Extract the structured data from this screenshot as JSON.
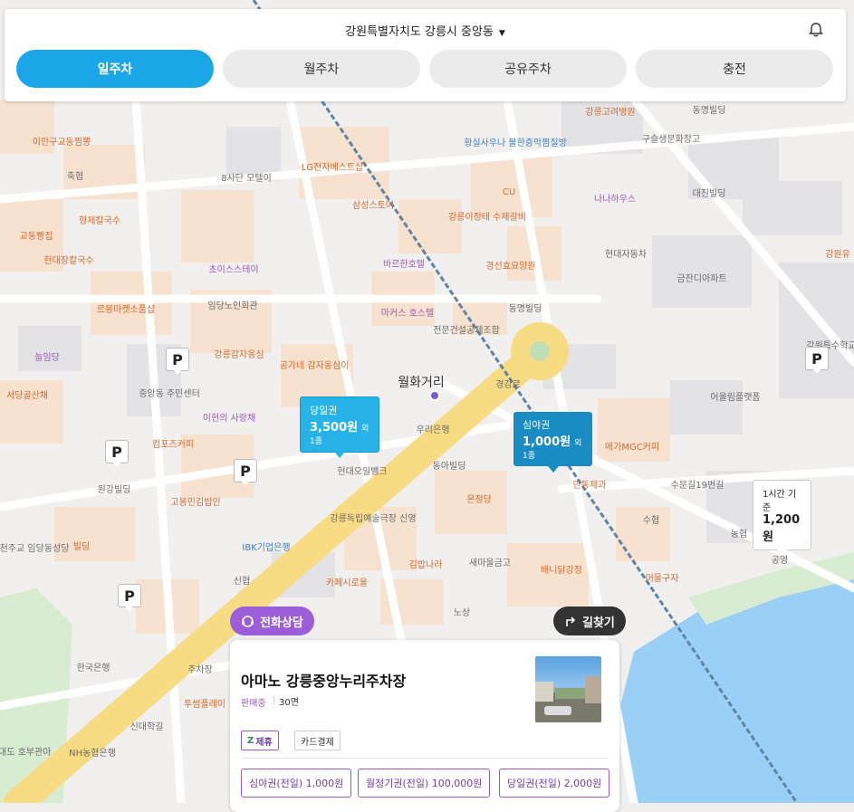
{
  "header": {
    "location": "강원특별자치도 강릉시 중앙동",
    "location_arrow": "▼"
  },
  "tabs": [
    {
      "label": "일주차",
      "active": true
    },
    {
      "label": "월주차",
      "active": false
    },
    {
      "label": "공유주차",
      "active": false
    },
    {
      "label": "충전",
      "active": false
    }
  ],
  "map": {
    "labels": [
      "강릉고려병원",
      "동명빌딩",
      "구슬생문화창고",
      "이만구교동찜뽕",
      "축협",
      "8사단 모텔이",
      "LG전자베스트샵",
      "황실사우나 불한증막찜질방",
      "CU",
      "나나하우스",
      "대진빌딩",
      "삼성스토어",
      "강릉이정태 수제갈비",
      "형제칼국수",
      "교동빵집",
      "현대장칼국수",
      "초이스스테이",
      "바르한호텔",
      "경선효요양원",
      "현대자동차",
      "금잔디아파트",
      "강원유",
      "임당노인회관",
      "르봉마켓소품샵",
      "마커스 호스텔",
      "동명빌딩",
      "전문건설공제조합",
      "늘임당",
      "강릉감자옹심",
      "공가네 감자옹심이",
      "서당골산채",
      "중앙동 주민센터",
      "이현의 사랑채",
      "월화거리",
      "우리은행",
      "어울림플랫폼",
      "강원특수학교",
      "컴포즈커피",
      "메가MGC커피",
      "동아빌딩",
      "현대오일뱅크",
      "원강빌딩",
      "고봉민김밥인",
      "온정당",
      "만동제과",
      "수문길19번길",
      "강릉독립예술극장 신영",
      "IBK기업은행",
      "천주교 임당동성당",
      "빌딩",
      "새마을금고",
      "김밥나라",
      "배니닭강정",
      "신협",
      "카페시로울",
      "머물구자",
      "농협",
      "공영",
      "노상",
      "한국은행",
      "주차장",
      "투썸플레이",
      "강릉대도 호부관아",
      "NH농협은행",
      "신대학길",
      "경강로",
      "수협"
    ]
  },
  "callouts": [
    {
      "title": "당일권",
      "price": "3,500원",
      "suffix": "외 1종"
    },
    {
      "title": "심야권",
      "price": "1,000원",
      "suffix": "외 1종"
    },
    {
      "title": "1시간 기준",
      "price": "1,200원",
      "suffix": ""
    }
  ],
  "parking_mark": "P",
  "buttons": {
    "phone": "전화상담",
    "directions": "길찾기"
  },
  "card": {
    "title": "아마노 강릉중앙누리주차장",
    "status": "판매중",
    "spaces": "30면",
    "tags": [
      "제휴",
      "카드결제"
    ],
    "prices": [
      "심야권(전일) 1,000원",
      "월정기권(전일) 100,000원",
      "당일권(전일) 2,000원"
    ]
  },
  "colors": {
    "accent": "#1ba6e8",
    "purple": "#9b5ed8",
    "water": "#9ad0f5",
    "road_yellow": "#f8dc83"
  }
}
